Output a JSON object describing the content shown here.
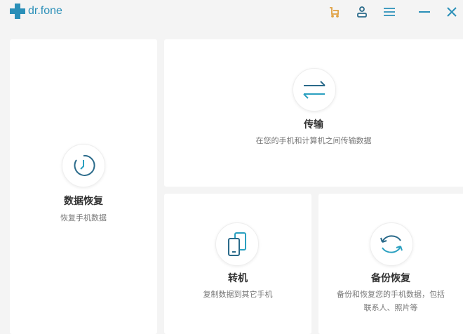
{
  "app": {
    "name": "dr.fone"
  },
  "toolbar": {
    "icons": [
      "cart-icon",
      "user-icon",
      "menu-icon",
      "minimize-icon",
      "close-icon"
    ],
    "cart_color": "#e0a040",
    "icon_color": "#2a8fb8"
  },
  "cards": {
    "recovery": {
      "title": "数据恢复",
      "desc": "恢复手机数据"
    },
    "transfer": {
      "title": "传输",
      "desc": "在您的手机和计算机之间传输数据"
    },
    "switch": {
      "title": "转机",
      "desc": "复制数据到其它手机"
    },
    "backup": {
      "title": "备份恢复",
      "desc1": "备份和恢复您的手机数据，包括",
      "desc2": "联系人、照片等"
    }
  }
}
